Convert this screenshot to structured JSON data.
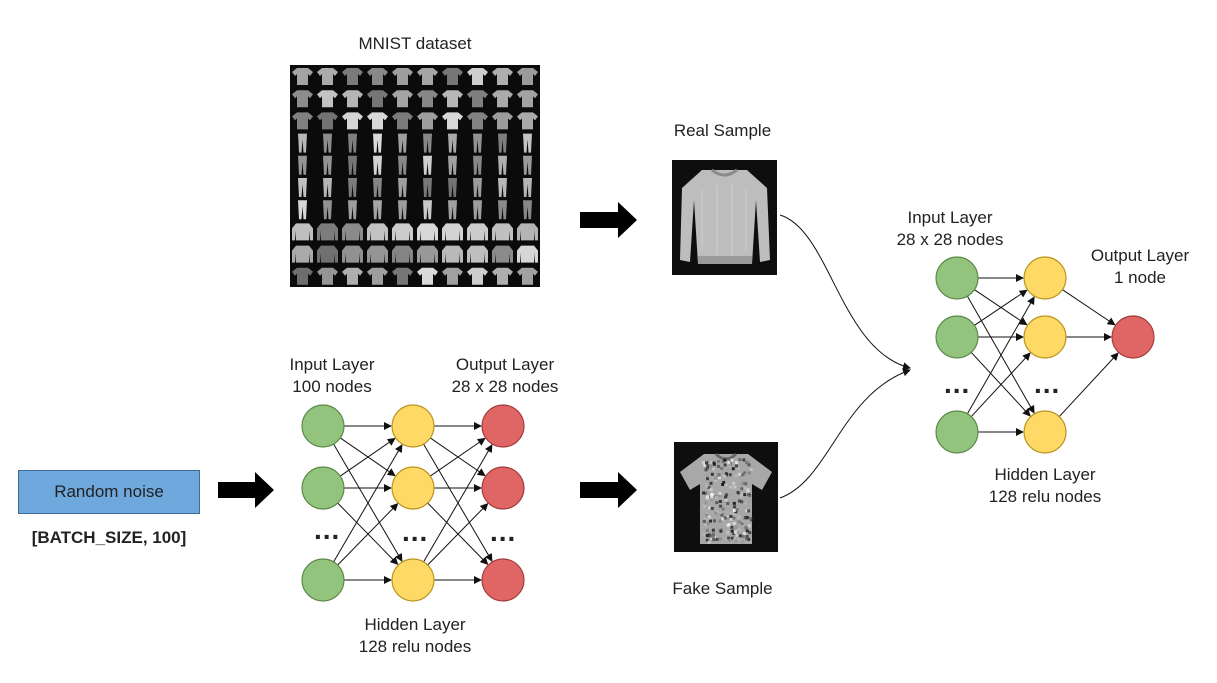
{
  "mnist": {
    "title": "MNIST dataset"
  },
  "real_sample": {
    "label": "Real Sample"
  },
  "fake_sample": {
    "label": "Fake Sample"
  },
  "noise": {
    "label": "Random noise",
    "shape": "[BATCH_SIZE,  100]"
  },
  "generator": {
    "input_layer": [
      "Input Layer",
      "100 nodes"
    ],
    "output_layer": [
      "Output Layer",
      "28 x 28 nodes"
    ],
    "hidden_layer": [
      "Hidden Layer",
      "128 relu nodes"
    ],
    "ellipsis": "..."
  },
  "discriminator": {
    "input_layer": [
      "Input Layer",
      "28 x 28 nodes"
    ],
    "output_layer": [
      "Output Layer",
      "1 node"
    ],
    "hidden_layer": [
      "Hidden Layer",
      "128 relu nodes"
    ],
    "ellipsis": "..."
  },
  "colors": {
    "input_node": "#93c47d",
    "hidden_node": "#ffd966",
    "output_node": "#e06666",
    "noise_box": "#6fa8dc"
  }
}
